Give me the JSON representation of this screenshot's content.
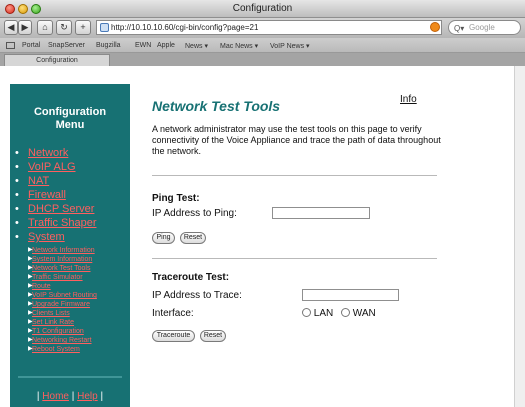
{
  "window": {
    "title": "Configuration"
  },
  "toolbar": {
    "back_glyph": "◀",
    "forward_glyph": "▶",
    "home_glyph": "⌂",
    "reload_glyph": "↻",
    "add_glyph": "+",
    "url": "http://10.10.10.60/cgi-bin/config?page=21",
    "search_placeholder": "Google",
    "search_glyph": "Q▾"
  },
  "bookmarks": {
    "items": [
      "Portal",
      "SnapServer",
      "Bugzilla",
      "EWN",
      "Apple",
      "News ▾",
      "Mac News ▾",
      "VoIP News ▾"
    ]
  },
  "tabs": [
    {
      "label": "Configuration"
    }
  ],
  "sidebar": {
    "menu_title_line1": "Configuration",
    "menu_title_line2": "Menu",
    "bullet": "•",
    "arrow": "▶",
    "items": [
      {
        "label": "Network"
      },
      {
        "label": "VoIP ALG"
      },
      {
        "label": "NAT"
      },
      {
        "label": "Firewall"
      },
      {
        "label": "DHCP Server"
      },
      {
        "label": "Traffic Shaper"
      },
      {
        "label": "System"
      }
    ],
    "sub_items": [
      "Network Information",
      "System Information",
      "Network Test Tools",
      "Traffic Simulator",
      "Route",
      "VoIP Subnet Routing",
      "Upgrade Firmware",
      "Clients Lists",
      "Set Link Rate",
      "T1 Configuration",
      "Networking Restart",
      "Reboot System"
    ],
    "footer": {
      "sep_open": "| ",
      "home": "Home",
      "sep_mid": " | ",
      "help": "Help",
      "sep_close": " |"
    }
  },
  "main": {
    "info": "Info",
    "title": "Network Test Tools",
    "description": "A network administrator may use the test tools on this page to verify connectivity of the Voice Appliance and trace the path of data throughout the network.",
    "ping": {
      "section_title": "Ping Test:",
      "label": "IP Address to Ping:",
      "value": "",
      "button": "Ping",
      "reset": "Reset"
    },
    "traceroute": {
      "section_title": "Traceroute Test:",
      "label": "IP Address to Trace:",
      "value": "",
      "interface_label": "Interface:",
      "option_lan": "LAN",
      "option_wan": "WAN",
      "button": "Traceroute",
      "reset": "Reset"
    }
  }
}
